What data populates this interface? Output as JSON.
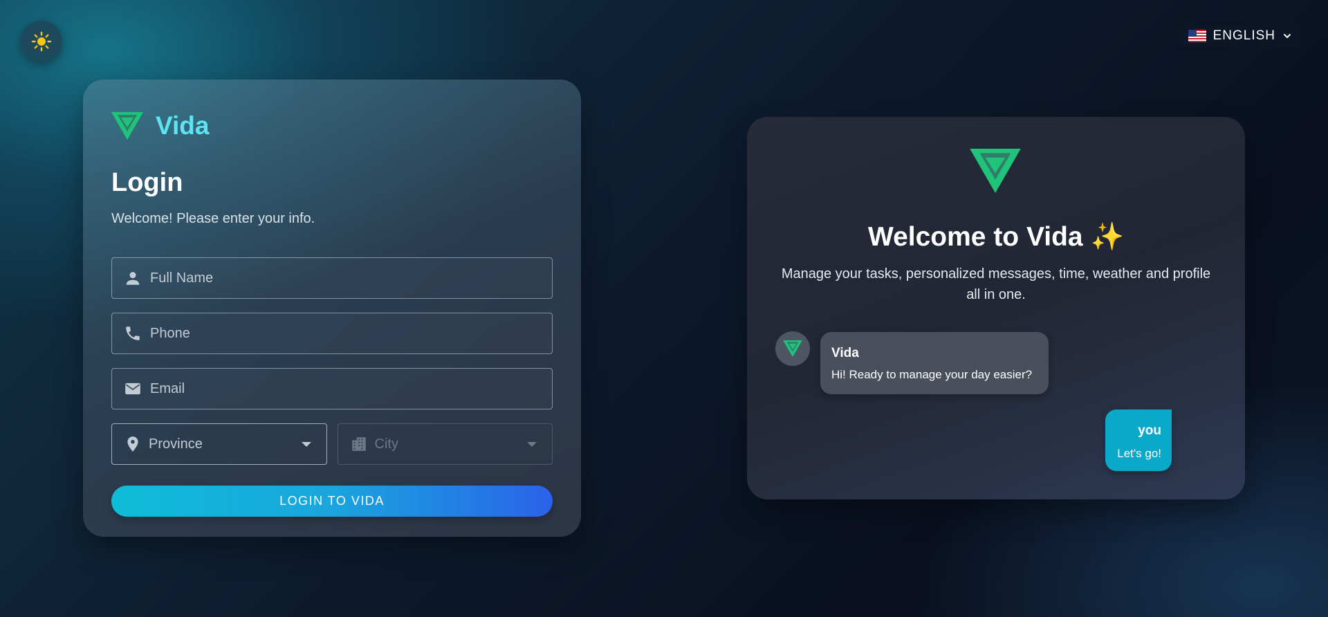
{
  "header": {
    "theme_toggle_icon": "sun-icon",
    "language": {
      "flag_icon": "us-flag-icon",
      "label": "ENGLISH",
      "chevron_icon": "chevron-down-icon"
    }
  },
  "login": {
    "brand_name": "Vida",
    "title": "Login",
    "subtitle": "Welcome! Please enter your info.",
    "fields": {
      "full_name": {
        "placeholder": "Full Name",
        "value": "",
        "icon": "person-icon"
      },
      "phone": {
        "placeholder": "Phone",
        "value": "",
        "icon": "phone-icon"
      },
      "email": {
        "placeholder": "Email",
        "value": "",
        "icon": "mail-icon"
      },
      "province": {
        "label": "Province",
        "icon": "location-pin-icon"
      },
      "city": {
        "label": "City",
        "icon": "city-icon"
      }
    },
    "submit_label": "LOGIN TO VIDA"
  },
  "welcome": {
    "title": "Welcome to Vida",
    "sparkle_emoji": "✨",
    "description": "Manage your tasks, personalized messages, time, weather and profile all in one.",
    "chat": [
      {
        "sender": "Vida",
        "text": "Hi! Ready to manage your day easier?"
      },
      {
        "sender": "you",
        "text": "Let's go!"
      }
    ]
  },
  "colors": {
    "brand_green": "#1fc47a",
    "brand_name_cyan": "#5ee3f2",
    "button_gradient_start": "#0ebdd8",
    "button_gradient_end": "#2a62ea",
    "user_bubble": "#0aa8c9",
    "bot_bubble": "#4a4f5c"
  }
}
